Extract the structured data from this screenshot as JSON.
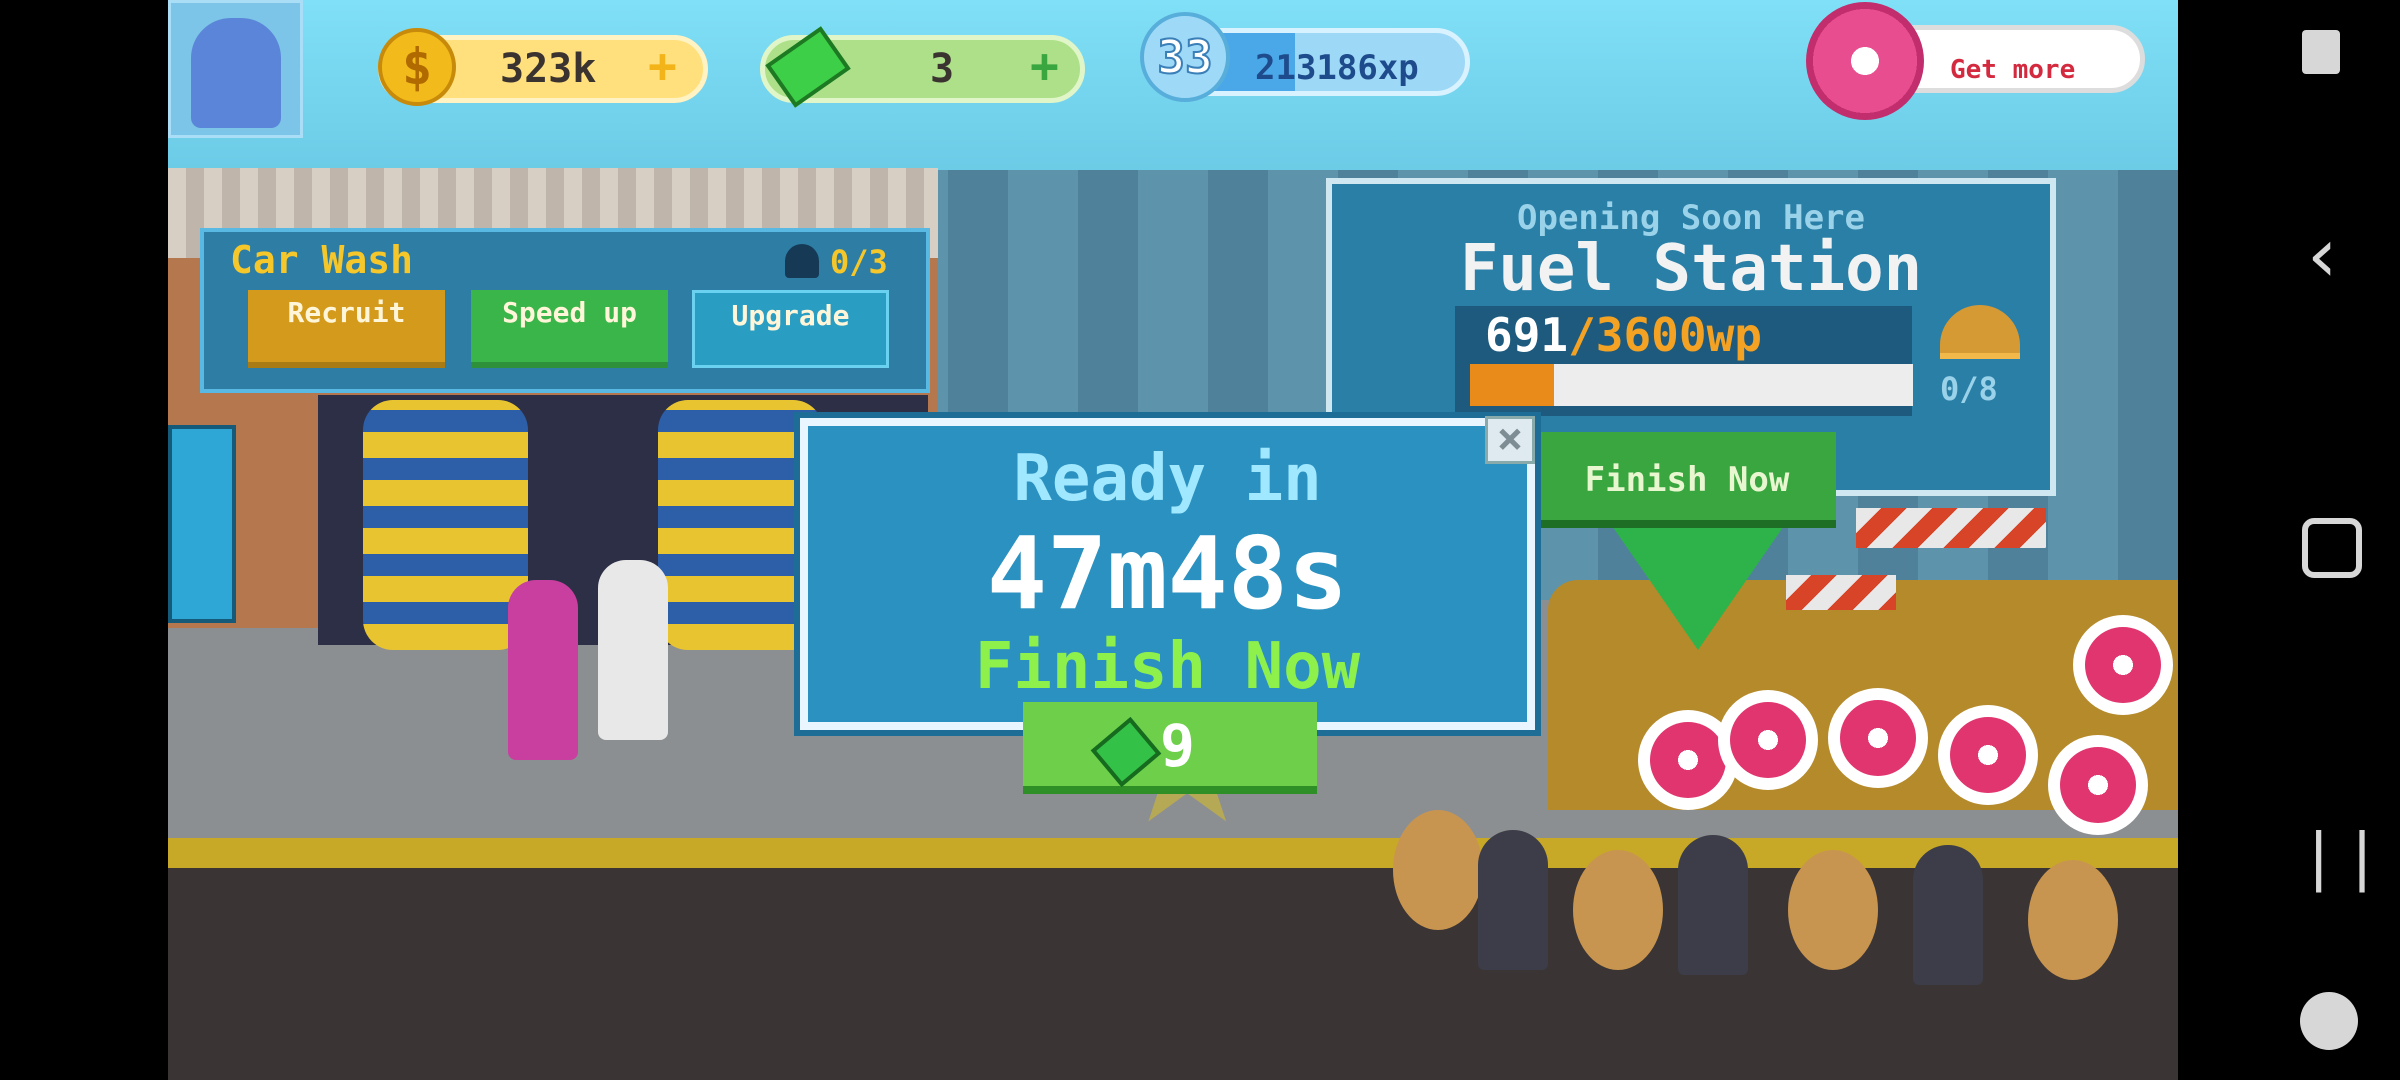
{
  "hud": {
    "coins": "323k",
    "cash": "3",
    "level": "33",
    "xp": "213186xp",
    "donut_button": "Get more",
    "add_symbol": "+",
    "xp_progress": 0.45
  },
  "car_wash": {
    "title": "Car Wash",
    "workers": "0/3",
    "buttons": {
      "recruit": "Recruit",
      "speed_up": "Speed up",
      "upgrade": "Upgrade"
    }
  },
  "fuel_station": {
    "subtitle": "Opening Soon Here",
    "title": "Fuel Station",
    "progress_current": "691",
    "progress_max": "/3600wp",
    "progress_fraction": 0.19,
    "workers": "0/8",
    "finish_button": "Finish Now"
  },
  "dialog": {
    "title": "Ready in",
    "time": "47m48s",
    "finish_label": "Finish Now",
    "cost": "9",
    "close_symbol": "×"
  },
  "colors": {
    "coin": "#f2bb1b",
    "cash": "#3ecf48",
    "donut": "#e84d8f",
    "dialog_bg": "#2b91c0",
    "finish_green": "#8ef04b"
  },
  "icons": {
    "touch": "touch-icon",
    "back": "back-icon",
    "home": "home-icon",
    "recents": "recents-icon",
    "game_tools": "game-controller-icon"
  }
}
